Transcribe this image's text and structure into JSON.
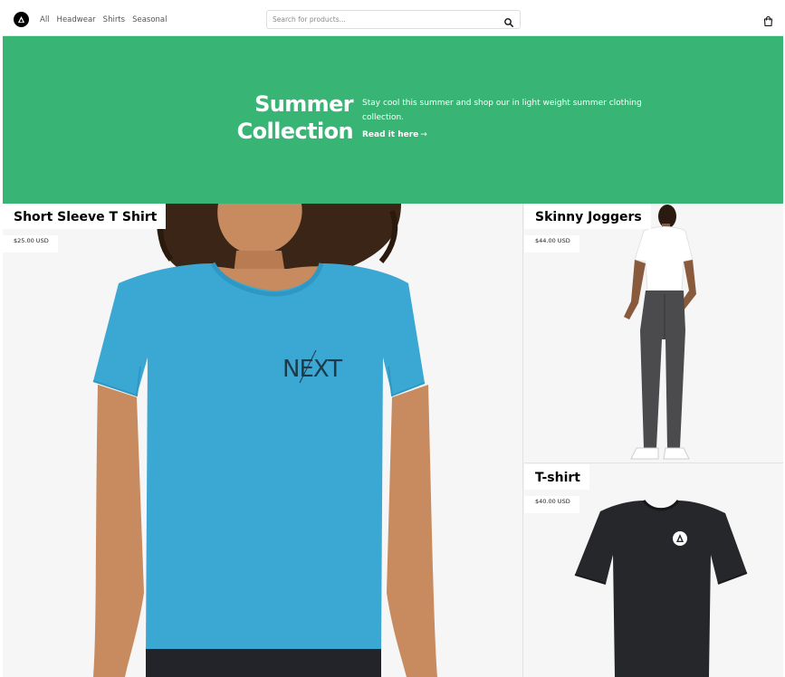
{
  "nav": {
    "links": [
      "All",
      "Headwear",
      "Shirts",
      "Seasonal"
    ],
    "search_placeholder": "Search for products..."
  },
  "hero": {
    "title_line1": "Summer",
    "title_line2": "Collection",
    "description": "Stay cool this summer and shop our in light weight summer clothing collection.",
    "link_label": "Read it here"
  },
  "products": [
    {
      "name": "Short Sleeve T Shirt",
      "price": "$25.00 USD"
    },
    {
      "name": "Skinny Joggers",
      "price": "$44.00 USD"
    },
    {
      "name": "T-shirt",
      "price": "$40.00 USD"
    }
  ],
  "colors": {
    "hero_bg": "#38b574",
    "tshirt_blue": "#3ba8d4",
    "tile_bg": "#f6f6f6"
  },
  "icons": [
    "store-logo-icon",
    "search-icon",
    "cart-icon",
    "arrow-right-icon"
  ],
  "print": {
    "shirt_logo": "NEXT"
  }
}
